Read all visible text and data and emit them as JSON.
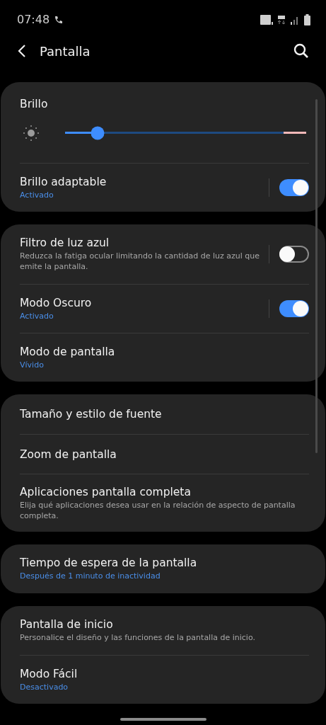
{
  "status_bar": {
    "time": "07:48"
  },
  "header": {
    "title": "Pantalla"
  },
  "sections": [
    {
      "items": [
        {
          "kind": "slider",
          "title": "Brillo",
          "level": 0.14
        },
        {
          "kind": "toggle",
          "title": "Brillo adaptable",
          "subtitle": "Activado",
          "subtitle_accent": true,
          "on": true
        }
      ]
    },
    {
      "items": [
        {
          "kind": "toggle",
          "title": "Filtro de luz azul",
          "subtitle": "Reduzca la fatiga ocular limitando la cantidad de luz azul que emite la pantalla.",
          "subtitle_accent": false,
          "on": false
        },
        {
          "kind": "toggle",
          "title": "Modo Oscuro",
          "subtitle": "Activado",
          "subtitle_accent": true,
          "on": true
        },
        {
          "kind": "link",
          "title": "Modo de pantalla",
          "subtitle": "Vívido",
          "subtitle_accent": true
        }
      ]
    },
    {
      "items": [
        {
          "kind": "link",
          "title": "Tamaño y estilo de fuente"
        },
        {
          "kind": "link",
          "title": "Zoom de pantalla"
        },
        {
          "kind": "link",
          "title": "Aplicaciones pantalla completa",
          "subtitle": "Elija qué aplicaciones desea usar en la relación de aspecto de pantalla completa.",
          "subtitle_accent": false
        }
      ]
    },
    {
      "items": [
        {
          "kind": "link",
          "title": "Tiempo de espera de la pantalla",
          "subtitle": "Después de 1 minuto de inactividad",
          "subtitle_accent": true
        }
      ]
    },
    {
      "items": [
        {
          "kind": "link",
          "title": "Pantalla de inicio",
          "subtitle": "Personalice el diseño y las funciones de la pantalla de inicio.",
          "subtitle_accent": false
        },
        {
          "kind": "link",
          "title": "Modo Fácil",
          "subtitle": "Desactivado",
          "subtitle_accent": true
        }
      ]
    }
  ]
}
